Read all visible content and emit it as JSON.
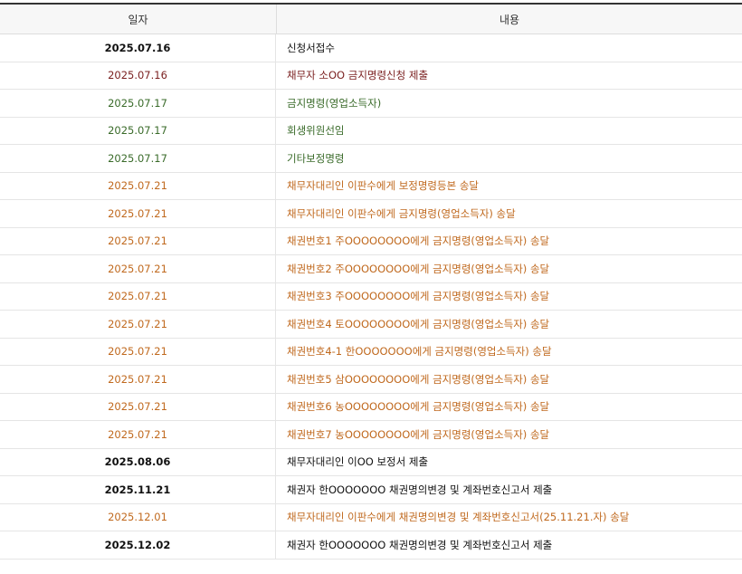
{
  "header": {
    "date_label": "일자",
    "content_label": "내용"
  },
  "colors": {
    "black": "#111111",
    "red": "#7a1f1f",
    "green": "#3a6b2a",
    "orange": "#c0691e"
  },
  "rows": [
    {
      "date": "2025.07.16",
      "content": "신청서접수",
      "tone": "bold"
    },
    {
      "date": "2025.07.16",
      "content": "채무자 소OO 금지명령신청 제출",
      "tone": "red"
    },
    {
      "date": "2025.07.17",
      "content": "금지명령(영업소득자)",
      "tone": "green"
    },
    {
      "date": "2025.07.17",
      "content": "회생위원선임",
      "tone": "green"
    },
    {
      "date": "2025.07.17",
      "content": "기타보정명령",
      "tone": "green"
    },
    {
      "date": "2025.07.21",
      "content": "채무자대리인 이판수에게 보정명령등본 송달",
      "tone": "orange"
    },
    {
      "date": "2025.07.21",
      "content": "채무자대리인 이판수에게 금지명령(영업소득자) 송달",
      "tone": "orange"
    },
    {
      "date": "2025.07.21",
      "content": "채권번호1 주OOOOOOOO에게 금지명령(영업소득자) 송달",
      "tone": "orange"
    },
    {
      "date": "2025.07.21",
      "content": "채권번호2 주OOOOOOOO에게 금지명령(영업소득자) 송달",
      "tone": "orange"
    },
    {
      "date": "2025.07.21",
      "content": "채권번호3 주OOOOOOOO에게 금지명령(영업소득자) 송달",
      "tone": "orange"
    },
    {
      "date": "2025.07.21",
      "content": "채권번호4 토OOOOOOOO에게 금지명령(영업소득자) 송달",
      "tone": "orange"
    },
    {
      "date": "2025.07.21",
      "content": "채권번호4-1 한OOOOOOO에게 금지명령(영업소득자) 송달",
      "tone": "orange"
    },
    {
      "date": "2025.07.21",
      "content": "채권번호5 삼OOOOOOOO에게 금지명령(영업소득자) 송달",
      "tone": "orange"
    },
    {
      "date": "2025.07.21",
      "content": "채권번호6 농OOOOOOOO에게 금지명령(영업소득자) 송달",
      "tone": "orange"
    },
    {
      "date": "2025.07.21",
      "content": "채권번호7 농OOOOOOOO에게 금지명령(영업소득자) 송달",
      "tone": "orange"
    },
    {
      "date": "2025.08.06",
      "content": "채무자대리인 이OO 보정서 제출",
      "tone": "bold"
    },
    {
      "date": "2025.11.21",
      "content": "채권자 한OOOOOOO 채권명의변경 및 계좌번호신고서 제출",
      "tone": "bold"
    },
    {
      "date": "2025.12.01",
      "content": "채무자대리인 이판수에게 채권명의변경 및 계좌번호신고서(25.11.21.자) 송달",
      "tone": "orange"
    },
    {
      "date": "2025.12.02",
      "content": "채권자 한OOOOOOO 채권명의변경 및 계좌번호신고서 제출",
      "tone": "bold"
    }
  ]
}
